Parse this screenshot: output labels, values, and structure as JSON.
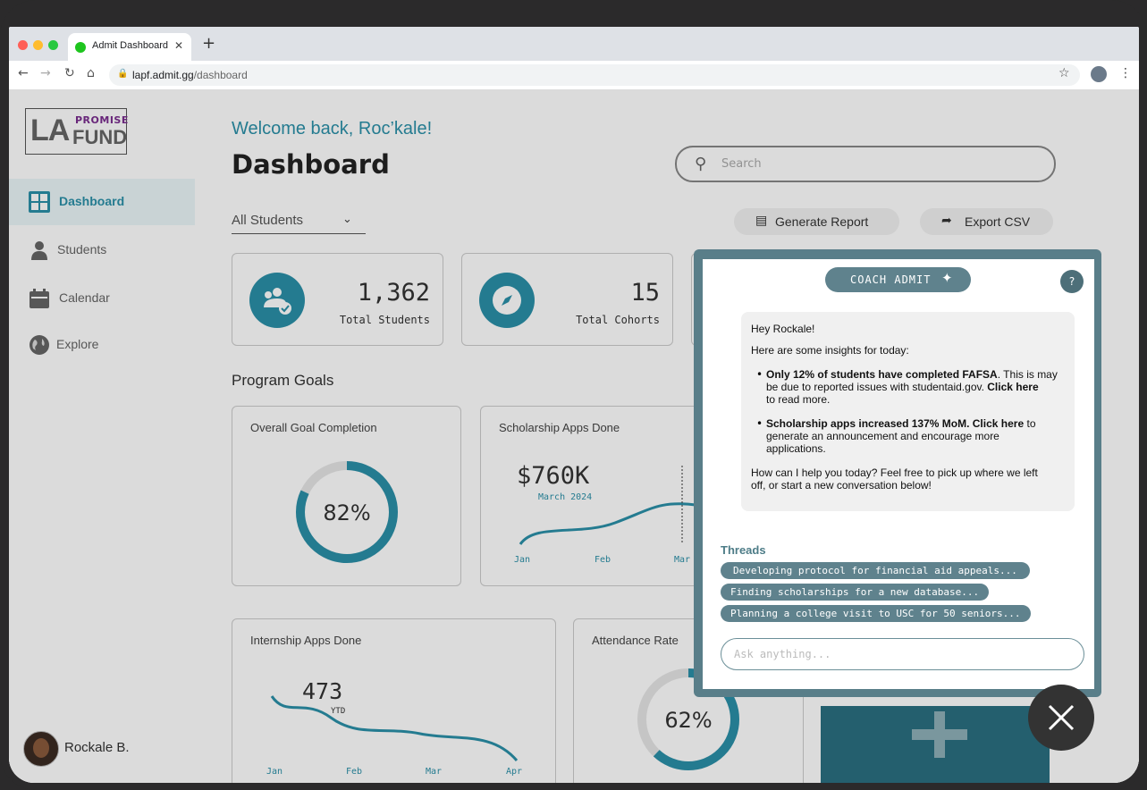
{
  "browser": {
    "tab_title": "Admit Dashboard",
    "url_host": "lapf.admit.gg",
    "url_path": "/dashboard"
  },
  "logo": {
    "la": "LA",
    "promise": "PROMISE",
    "fund": "FUND"
  },
  "sidebar": {
    "items": [
      {
        "label": "Dashboard",
        "icon": "grid-icon"
      },
      {
        "label": "Students",
        "icon": "person-icon"
      },
      {
        "label": "Calendar",
        "icon": "calendar-icon"
      },
      {
        "label": "Explore",
        "icon": "globe-icon"
      }
    ],
    "user_name": "Rockale B."
  },
  "header": {
    "welcome": "Welcome back, Roc’kale!",
    "title": "Dashboard",
    "search_placeholder": "Search"
  },
  "filter": {
    "selected": "All Students"
  },
  "actions": {
    "generate": "Generate Report",
    "export": "Export CSV"
  },
  "stats": [
    {
      "value": "1,362",
      "label": "Total Students"
    },
    {
      "value": "15",
      "label": "Total Cohorts"
    }
  ],
  "program_goals": {
    "heading": "Program Goals",
    "overall": {
      "title": "Overall Goal Completion",
      "value": "82%",
      "fraction": 0.82
    },
    "scholarship": {
      "title": "Scholarship Apps Done",
      "value": "$760K",
      "sub": "March 2024",
      "months": [
        "Jan",
        "Feb",
        "Mar"
      ]
    },
    "internship": {
      "title": "Internship Apps Done",
      "value": "473",
      "sub": "YTD",
      "months": [
        "Jan",
        "Feb",
        "Mar",
        "Apr"
      ]
    },
    "attendance": {
      "title": "Attendance Rate",
      "value": "62%",
      "fraction": 0.62
    }
  },
  "coach": {
    "title": "COACH ADMIT",
    "help": "?",
    "greeting": "Hey Rockale!",
    "intro": "Here are some insights for today:",
    "insight1_bold": "Only 12% of students have completed FAFSA",
    "insight1_line1_rest": ". This is may",
    "insight1_line2_a": "be due to reported issues with studentaid.gov. ",
    "insight1_link": "Click here",
    "insight1_line3": "to read more.",
    "insight2_bold": "Scholarship apps increased 137% MoM.",
    "insight2_link": "Click here",
    "insight2_rest1": "to",
    "insight2_rest2": "generate an announcement and encourage more",
    "insight2_rest3": "applications.",
    "closing1": "How can I help you today? Feel free to pick up where we left",
    "closing2": "off, or start a new conversation below!",
    "threads_heading": "Threads",
    "threads": [
      "Developing protocol for financial aid appeals...",
      "Finding scholarships for a new database...",
      "Planning a college visit to USC for 50 seniors..."
    ],
    "ask_placeholder": "Ask anything..."
  },
  "colors": {
    "accent": "#2b90a8",
    "coach": "#5f828d",
    "text": "#333333"
  }
}
